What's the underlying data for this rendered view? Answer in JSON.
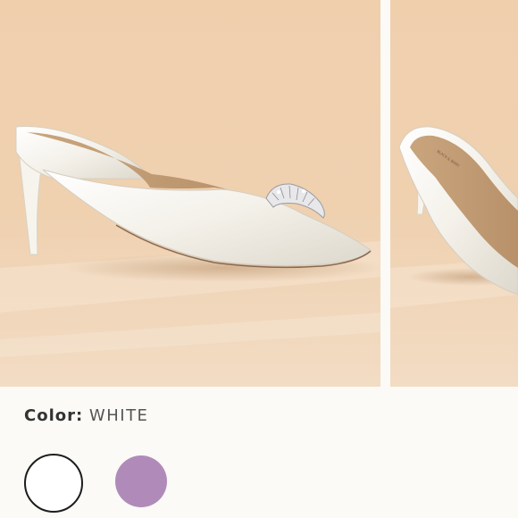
{
  "product": {
    "color_label": "Color:",
    "color_value": "WHITE"
  },
  "swatches": [
    {
      "name": "white",
      "hex": "#ffffff",
      "selected": true
    },
    {
      "name": "lilac",
      "hex": "#b08bba",
      "selected": false
    }
  ],
  "gallery": {
    "images": [
      "white satin embellished pointed-toe mule",
      "white mule side view"
    ]
  }
}
